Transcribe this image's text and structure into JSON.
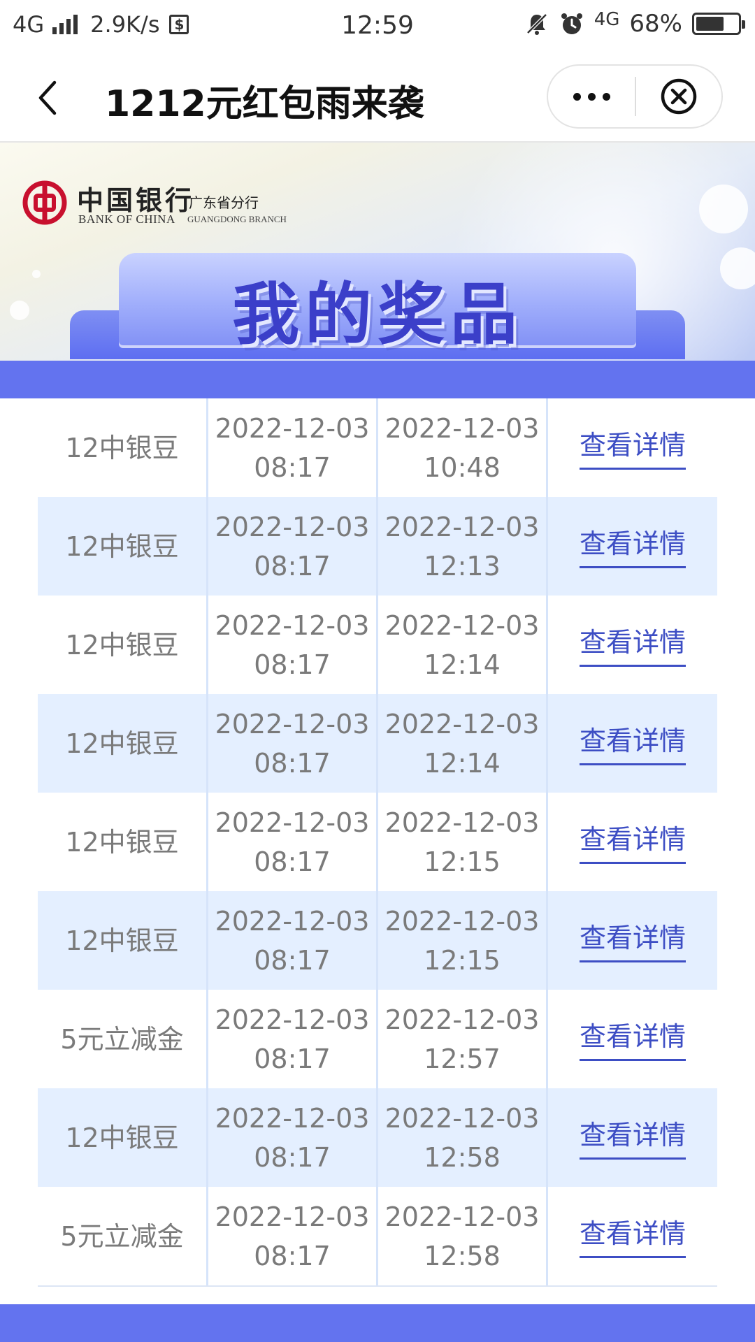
{
  "status_bar": {
    "network": "4G",
    "speed": "2.9K/s",
    "time": "12:59",
    "network_right": "4G",
    "battery": "68%",
    "battery_level": 0.68
  },
  "nav": {
    "title": "1212元红包雨来袭"
  },
  "banner": {
    "bank_name_cn": "中国银行",
    "branch_cn": "广东省分行",
    "bank_name_en": "BANK OF CHINA",
    "branch_en": "GUANGDONG BRANCH",
    "title": "我的奖品"
  },
  "prizes": [
    {
      "name": "12中银豆",
      "date1": "2022-12-03",
      "time1": "08:17",
      "date2": "2022-12-03",
      "time2": "10:48",
      "action": "查看详情"
    },
    {
      "name": "12中银豆",
      "date1": "2022-12-03",
      "time1": "08:17",
      "date2": "2022-12-03",
      "time2": "12:13",
      "action": "查看详情"
    },
    {
      "name": "12中银豆",
      "date1": "2022-12-03",
      "time1": "08:17",
      "date2": "2022-12-03",
      "time2": "12:14",
      "action": "查看详情"
    },
    {
      "name": "12中银豆",
      "date1": "2022-12-03",
      "time1": "08:17",
      "date2": "2022-12-03",
      "time2": "12:14",
      "action": "查看详情"
    },
    {
      "name": "12中银豆",
      "date1": "2022-12-03",
      "time1": "08:17",
      "date2": "2022-12-03",
      "time2": "12:15",
      "action": "查看详情"
    },
    {
      "name": "12中银豆",
      "date1": "2022-12-03",
      "time1": "08:17",
      "date2": "2022-12-03",
      "time2": "12:15",
      "action": "查看详情"
    },
    {
      "name": "5元立减金",
      "date1": "2022-12-03",
      "time1": "08:17",
      "date2": "2022-12-03",
      "time2": "12:57",
      "action": "查看详情"
    },
    {
      "name": "12中银豆",
      "date1": "2022-12-03",
      "time1": "08:17",
      "date2": "2022-12-03",
      "time2": "12:58",
      "action": "查看详情"
    },
    {
      "name": "5元立减金",
      "date1": "2022-12-03",
      "time1": "08:17",
      "date2": "2022-12-03",
      "time2": "12:58",
      "action": "查看详情"
    }
  ],
  "colors": {
    "accent": "#6373ef",
    "link": "#3d4ec4",
    "row_alt": "#e4efff",
    "brand_red": "#c8102e"
  },
  "icons": {
    "back": "chevron-left-icon",
    "more": "more-dots-icon",
    "close": "close-circle-icon",
    "mute": "bell-off-icon",
    "alarm": "alarm-icon"
  }
}
